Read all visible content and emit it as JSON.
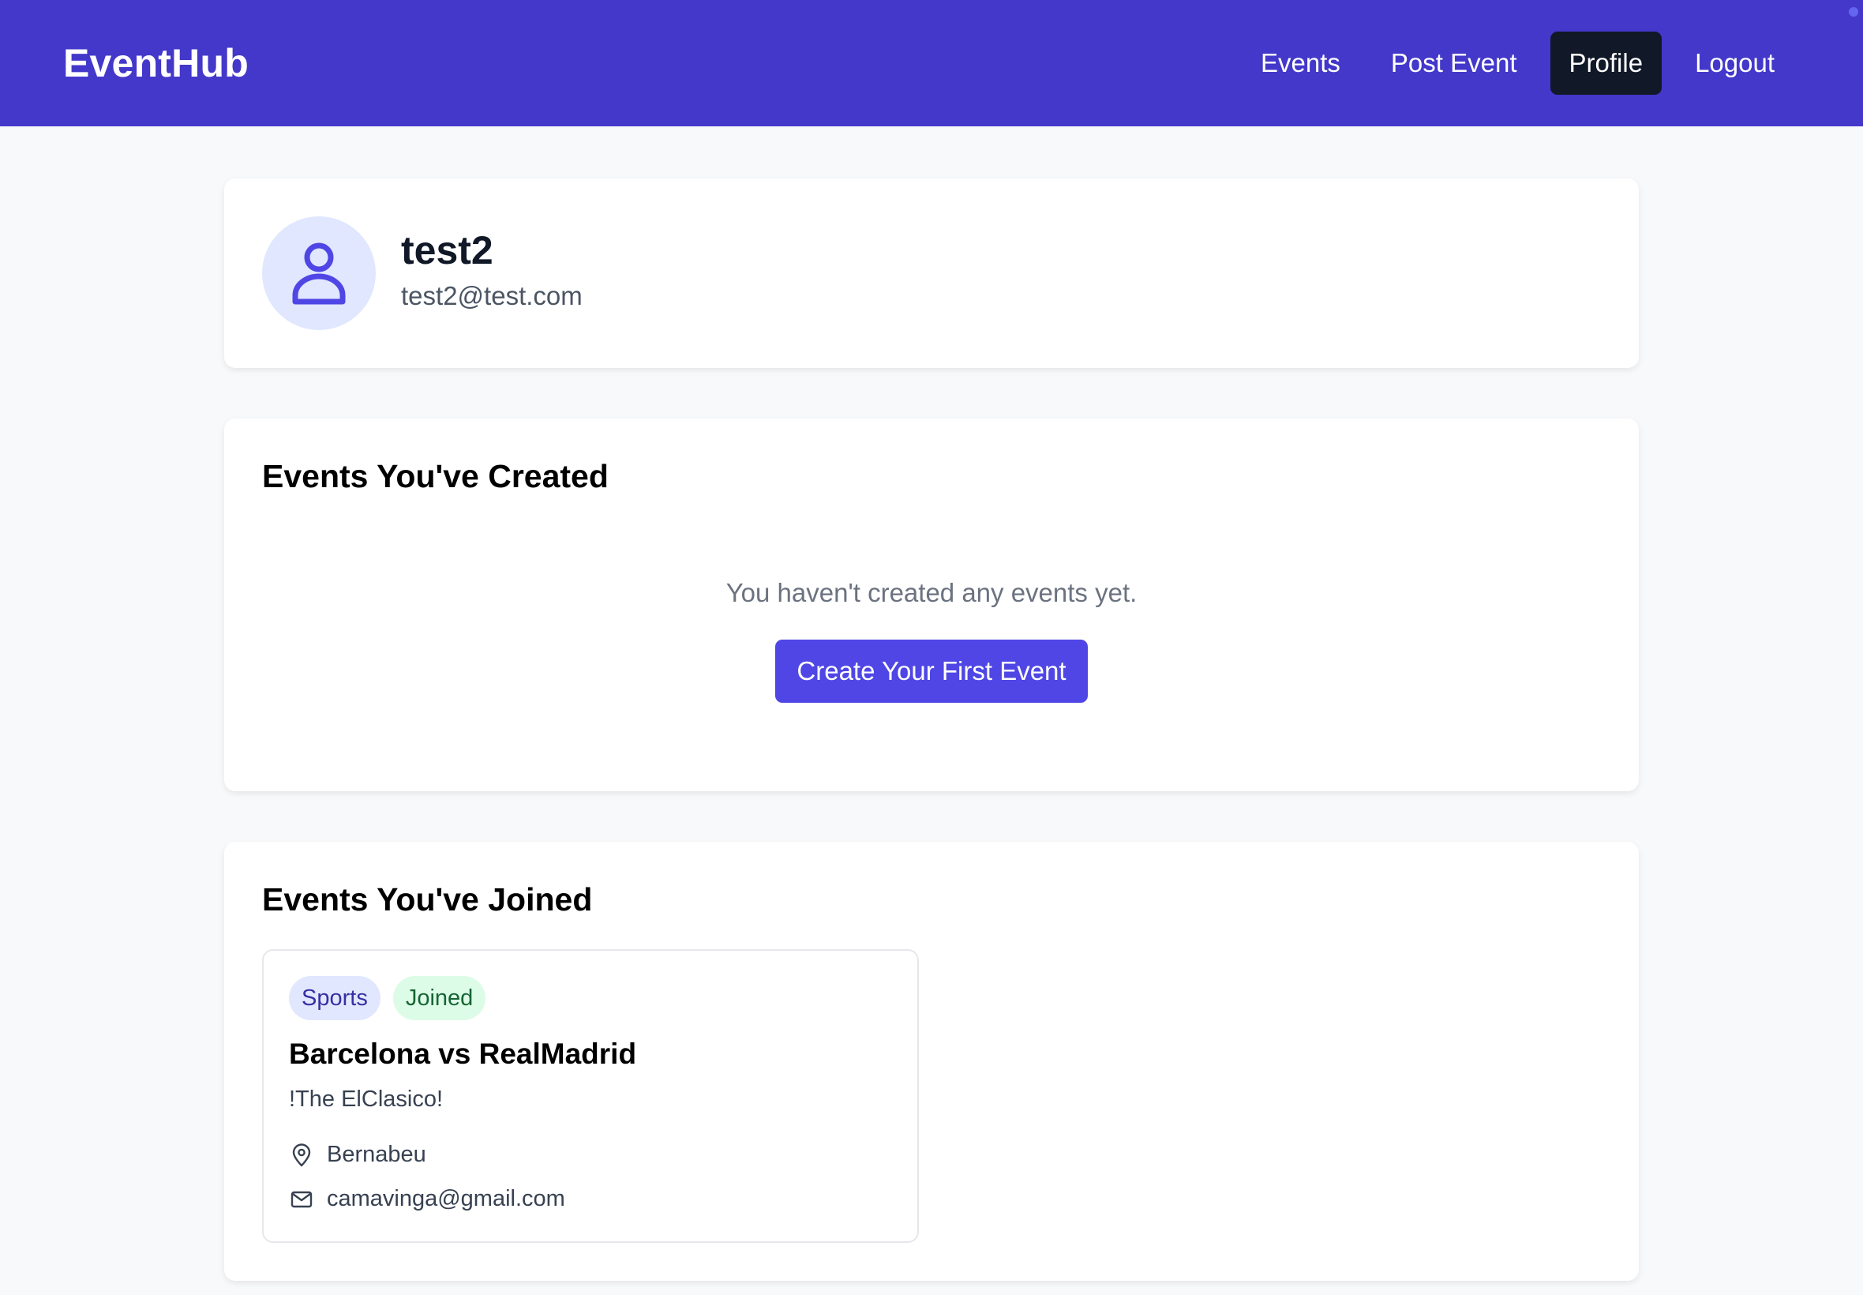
{
  "navbar": {
    "brand": "EventHub",
    "links": [
      "Events",
      "Post Event",
      "Profile",
      "Logout"
    ],
    "active": "Profile",
    "color": "#4338ca"
  },
  "profile": {
    "username": "test2",
    "email": "test2@test.com",
    "avatar_icon": "user-icon"
  },
  "created_section": {
    "title": "Events You've Created",
    "empty_message": "You haven't created any events yet.",
    "button_label": "Create Your First Event"
  },
  "joined_section": {
    "title": "Events You've Joined",
    "events": [
      {
        "category": "Sports",
        "status": "Joined",
        "title": "Barcelona vs RealMadrid",
        "description": "!The ElClasico!",
        "location": "Bernabeu",
        "contact": "camavinga@gmail.com"
      }
    ]
  },
  "colors": {
    "accent": "#4f46e5",
    "active_nav": "#111827",
    "sports_badge": "#e0e7ff",
    "joined_badge": "#dcfce7"
  }
}
